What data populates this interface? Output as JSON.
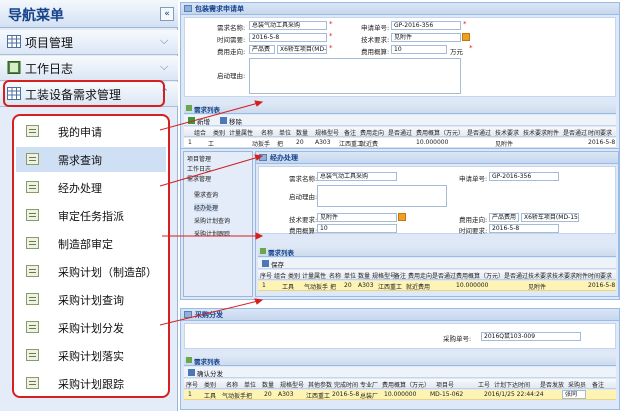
{
  "nav": {
    "title": "导航菜单",
    "collapse_glyph": "«",
    "groups": [
      {
        "label": "项目管理",
        "icon": "table-icon"
      },
      {
        "label": "工作日志",
        "icon": "book-icon"
      },
      {
        "label": "工装设备需求管理",
        "icon": "table-icon"
      }
    ],
    "items": [
      "我的申请",
      "需求查询",
      "经办处理",
      "审定任务指派",
      "制造部审定",
      "采购计划（制造部）",
      "采购计划查询",
      "采购计划分发",
      "采购计划落实",
      "采购计划跟踪"
    ]
  },
  "win1": {
    "title": "包装需求申请单",
    "form": {
      "req_name_label": "需求名称:",
      "req_name": "总装气动工具采购",
      "apply_no_label": "申请单号:",
      "apply_no": "GP-2016-356",
      "time_label": "时间需要:",
      "time": "2016-5-8",
      "tech_label": "技术要求:",
      "tech": "见附件",
      "cost_dir_label": "费用走向:",
      "cost_dir_a": "产品费",
      "cost_dir_b": "X6轿车项目(MD-15)",
      "budget_label": "费用概算:",
      "budget": "10",
      "budget_unit": "万元",
      "reason_label": "启动理由:"
    },
    "grid_title": "需求列表",
    "toolbar": {
      "add": "新增",
      "delete": "移除"
    },
    "columns": [
      "组合",
      "类别",
      "计量属性",
      "名称",
      "单位",
      "数量",
      "规格型号",
      "备注",
      "费用走向",
      "是否通过",
      "费用概算（万元）",
      "是否通过",
      "技术要求",
      "技术要求附件",
      "是否通过",
      "时间要求",
      "是否"
    ],
    "row": {
      "num": "1",
      "category": "工",
      "name": "动扳手",
      "unit": "把",
      "qty": "20",
      "model": "A303",
      "note": "江西重工",
      "cost_dir": "就近费",
      "budget": "10.000000",
      "tech": "见附件",
      "time": "2016-5-8"
    }
  },
  "win2": {
    "title": "经办处理",
    "mini_nav": [
      "项目管理",
      "工作日志",
      "需求管理",
      "需求查询",
      "经办处理",
      "采购计划查询",
      "采购计划跟踪"
    ],
    "form": {
      "req_name_label": "需求名称:",
      "req_name": "总装气动工具采购",
      "apply_no_label": "申请单号:",
      "apply_no": "GP-2016-356",
      "reason_label": "启动理由:",
      "tech_label": "技术要求:",
      "tech": "见附件",
      "cost_dir_label": "费用走向:",
      "cost_dir_a": "产品费用",
      "cost_dir_b": "X6轿车项目(MD-15-05)",
      "budget_label": "费用概算:",
      "budget": "10",
      "time_label": "时间要求:",
      "time": "2016-5-8"
    },
    "grid_title": "需求列表",
    "toolbar": {
      "save": "保存"
    },
    "columns": [
      "序号",
      "组合",
      "类别",
      "计量属性",
      "名称",
      "单位",
      "数量",
      "规格型号",
      "备注",
      "费用走向",
      "是否通过",
      "费用概算（万元）",
      "是否通过",
      "技术要求",
      "技术要求附件",
      "是否通过",
      "时间要求"
    ],
    "row": {
      "num": "1",
      "category": "工具",
      "name": "气动扳手",
      "unit": "把",
      "qty": "20",
      "model": "A303",
      "note": "江西重工",
      "cost_dir": "就近费用",
      "budget": "10.000000",
      "tech": "见附件",
      "time": "2016-5-8"
    }
  },
  "win3": {
    "title": "采购分发",
    "purchase_no_label": "采购单号:",
    "purchase_no": "2016Q鼠103-009",
    "grid_title": "需求列表",
    "toolbar": {
      "confirm": "确认分发"
    },
    "columns": [
      "序号",
      "类别",
      "名称",
      "单位",
      "数量",
      "规格型号",
      "其他参数",
      "完成时间",
      "专业厂",
      "费用概算（万元）",
      "项目号",
      "工号",
      "计划下达时间",
      "是否发放",
      "采购员",
      "备注"
    ],
    "row": {
      "num": "1",
      "category": "工具",
      "name": "气动扳手",
      "unit": "把",
      "qty": "20",
      "model": "A303",
      "other": "江西重工",
      "finish": "2016-5-8",
      "factory": "总装厂",
      "budget": "10.000000",
      "project": "MD-15-062",
      "job": "",
      "plan_time": "2016/1/25 22:44:24",
      "issued": "",
      "buyer": "张同"
    }
  },
  "colors": {
    "nav_bg": "#e3ecf8",
    "window_border": "#99bbe8",
    "row_highlight": "#fdf3b2",
    "annotation_red": "#d62020"
  }
}
